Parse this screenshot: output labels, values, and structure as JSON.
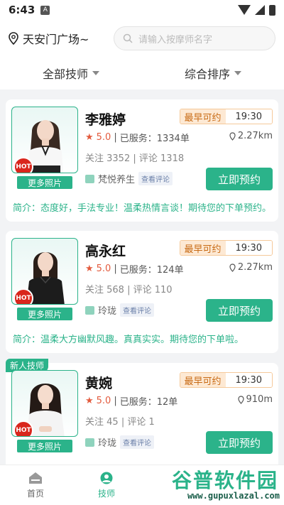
{
  "status": {
    "time": "6:43",
    "notif_icon": "A"
  },
  "location": {
    "text": "天安门广场~"
  },
  "search": {
    "placeholder": "请输入按摩师名字"
  },
  "filters": [
    {
      "label": "全部技师"
    },
    {
      "label": "综合排序"
    }
  ],
  "common": {
    "earliest_label": "最早可约",
    "more_photos": "更多照片",
    "hot": "HOT",
    "book": "立即预约",
    "view_reviews": "查看评论",
    "new_tag": "新人技师",
    "sep": "|"
  },
  "cards": [
    {
      "name": "李雅婷",
      "time": "19:30",
      "rating": "5.0",
      "served": "已服务：1334单",
      "distance": "2.27km",
      "follow": "关注 3352",
      "comments": "评论 1318",
      "shop": "梵悦养生",
      "intro": "简介：态度好，手法专业！温柔热情言谈！期待您的下单预约。"
    },
    {
      "name": "高永红",
      "time": "19:30",
      "rating": "5.0",
      "served": "已服务：124单",
      "distance": "2.27km",
      "follow": "关注 568",
      "comments": "评论 110",
      "shop": "玲珑",
      "intro": "简介：温柔大方幽默风趣。真真实实。期待您的下单啦。"
    },
    {
      "name": "黄婉",
      "time": "19:30",
      "rating": "5.0",
      "served": "已服务：12单",
      "distance": "910m",
      "follow": "关注 45",
      "comments": "评论 1",
      "shop": "玲珑"
    }
  ],
  "tabs": [
    {
      "label": "首页"
    },
    {
      "label": "技师"
    }
  ],
  "watermark": {
    "title": "谷普软件园",
    "url": "www.gupuxlazal.com"
  },
  "colors": {
    "accent": "#2bb38a",
    "hot": "#d9261c",
    "star": "#e35b3e",
    "earliest_bg": "#fde9d4"
  }
}
